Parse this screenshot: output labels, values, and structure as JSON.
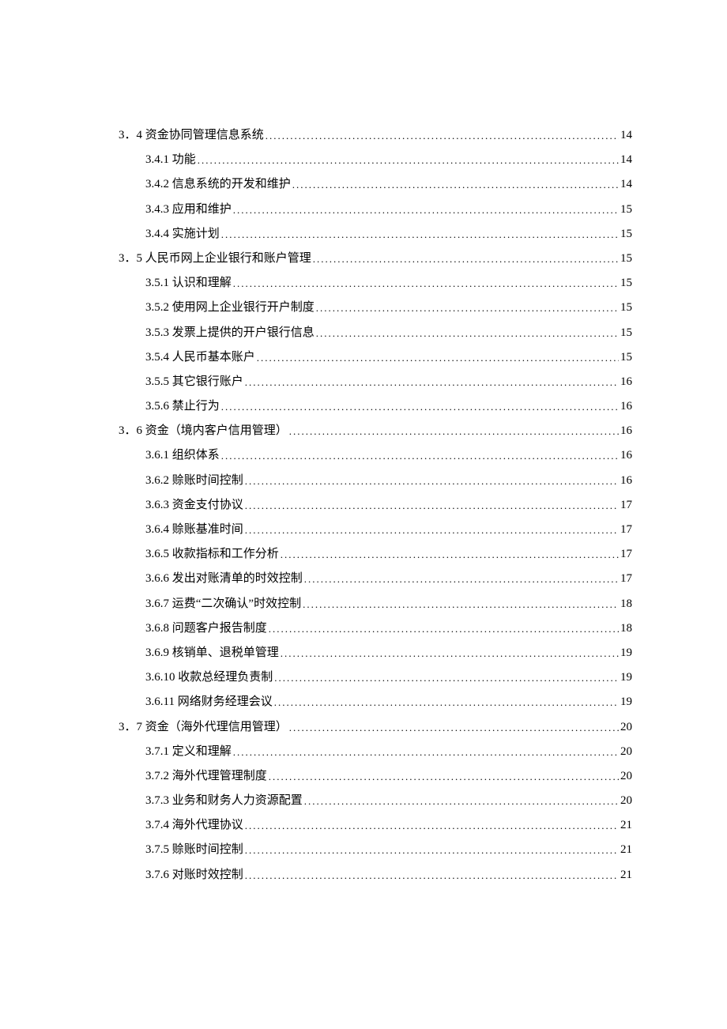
{
  "toc": [
    {
      "level": 1,
      "label": "3．4 资金协同管理信息系统",
      "page": "14"
    },
    {
      "level": 2,
      "label": "3.4.1 功能",
      "page": "14"
    },
    {
      "level": 2,
      "label": "3.4.2 信息系统的开发和维护",
      "page": "14"
    },
    {
      "level": 2,
      "label": "3.4.3 应用和维护",
      "page": "15"
    },
    {
      "level": 2,
      "label": "3.4.4 实施计划",
      "page": "15"
    },
    {
      "level": 1,
      "label": "3．5 人民币网上企业银行和账户管理",
      "page": "15"
    },
    {
      "level": 2,
      "label": "3.5.1 认识和理解",
      "page": "15"
    },
    {
      "level": 2,
      "label": "3.5.2 使用网上企业银行开户制度",
      "page": "15"
    },
    {
      "level": 2,
      "label": "3.5.3 发票上提供的开户银行信息",
      "page": "15"
    },
    {
      "level": 2,
      "label": "3.5.4 人民币基本账户",
      "page": "15"
    },
    {
      "level": 2,
      "label": "3.5.5 其它银行账户",
      "page": "16"
    },
    {
      "level": 2,
      "label": "3.5.6 禁止行为",
      "page": "16"
    },
    {
      "level": 1,
      "label": "3．6 资金（境内客户信用管理）",
      "page": "16"
    },
    {
      "level": 2,
      "label": "3.6.1 组织体系",
      "page": "16"
    },
    {
      "level": 2,
      "label": "3.6.2 赊账时间控制",
      "page": "16"
    },
    {
      "level": 2,
      "label": "3.6.3 资金支付协议",
      "page": "17"
    },
    {
      "level": 2,
      "label": "3.6.4 赊账基准时间",
      "page": "17"
    },
    {
      "level": 2,
      "label": "3.6.5 收款指标和工作分析",
      "page": "17"
    },
    {
      "level": 2,
      "label": "3.6.6 发出对账清单的时效控制",
      "page": "17"
    },
    {
      "level": 2,
      "label": "3.6.7 运费“二次确认”时效控制",
      "page": "18"
    },
    {
      "level": 2,
      "label": "3.6.8 问题客户报告制度",
      "page": "18"
    },
    {
      "level": 2,
      "label": "3.6.9 核销单、退税单管理",
      "page": "19"
    },
    {
      "level": 2,
      "label": "3.6.10 收款总经理负责制",
      "page": "19"
    },
    {
      "level": 2,
      "label": "3.6.11 网络财务经理会议",
      "page": "19"
    },
    {
      "level": 1,
      "label": "3．7 资金（海外代理信用管理）",
      "page": "20"
    },
    {
      "level": 2,
      "label": "3.7.1 定义和理解",
      "page": "20"
    },
    {
      "level": 2,
      "label": "3.7.2 海外代理管理制度",
      "page": "20"
    },
    {
      "level": 2,
      "label": "3.7.3 业务和财务人力资源配置",
      "page": "20"
    },
    {
      "level": 2,
      "label": "3.7.4 海外代理协议",
      "page": "21"
    },
    {
      "level": 2,
      "label": "3.7.5 赊账时间控制",
      "page": "21"
    },
    {
      "level": 2,
      "label": "3.7.6 对账时效控制",
      "page": "21"
    }
  ]
}
